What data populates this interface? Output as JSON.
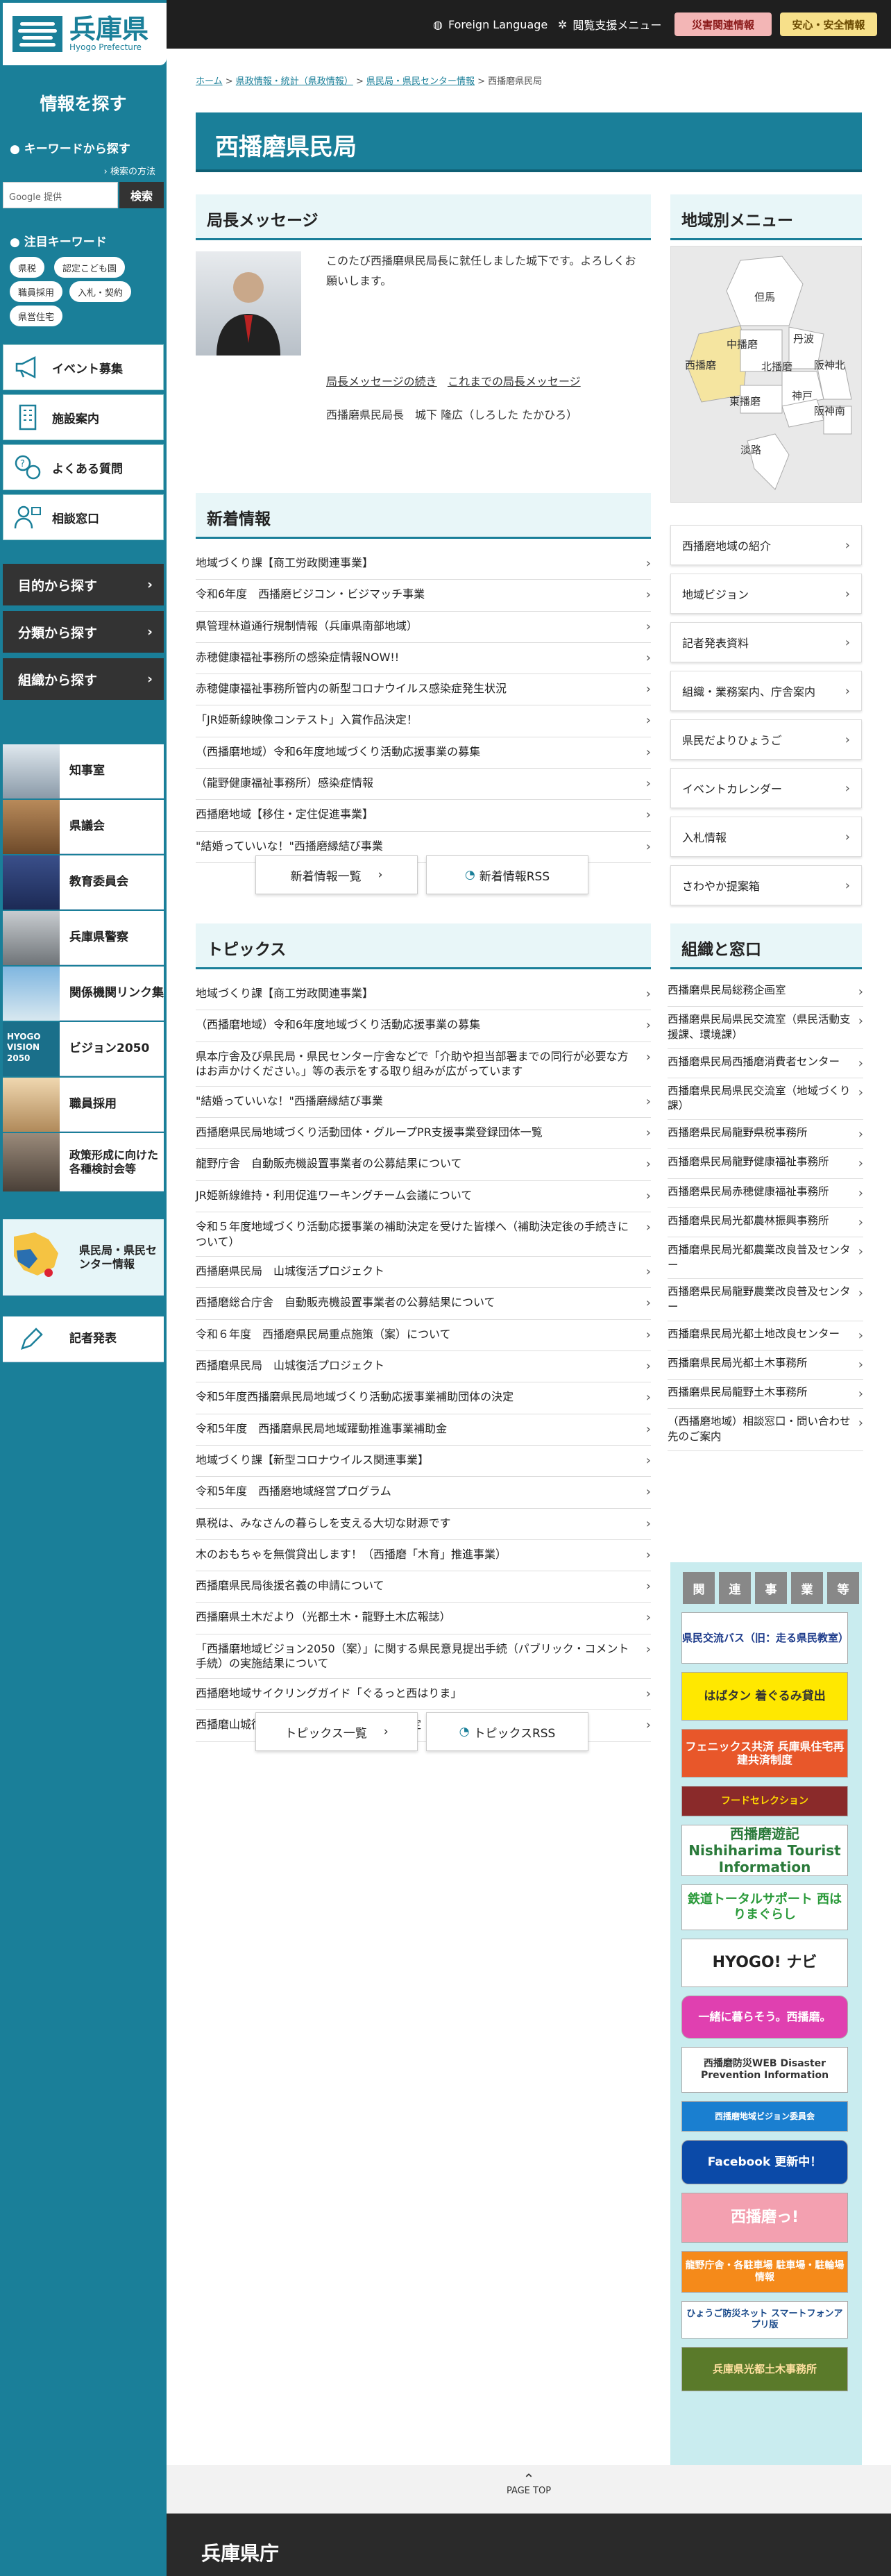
{
  "header": {
    "logo_title": "兵庫県",
    "logo_sub": "Hyogo Prefecture",
    "foreign": "Foreign Language",
    "browse_support": "閲覧支援メニュー",
    "disaster": "災害関連情報",
    "safety": "安心・安全情報"
  },
  "sidebar": {
    "heading": "情報を探す",
    "keyword_heading": "キーワードから探す",
    "search_howto": "検索の方法",
    "search_placeholder": "Google 提供",
    "search_button": "検索",
    "hot_heading": "注目キーワード",
    "tags": [
      "県税",
      "認定こども園",
      "職員採用",
      "入札・契約",
      "県営住宅"
    ],
    "quick": [
      "イベント募集",
      "施設案内",
      "よくある質問",
      "相談窓口"
    ],
    "find": [
      "目的から探す",
      "分類から探す",
      "組織から探す"
    ],
    "pics": [
      "知事室",
      "県議会",
      "教育委員会",
      "兵庫県警察",
      "関係機関リンク集",
      "ビジョン2050",
      "職員採用",
      "政策形成に向けた各種検討会等"
    ],
    "vision_text": "HYOGO VISION 2050",
    "map_link": "県民局・県民センター情報",
    "press": "記者発表"
  },
  "breadcrumb": {
    "items": [
      "ホーム",
      "県政情報・統計（県政情報）",
      "県民局・県民センター情報"
    ],
    "current": "西播磨県民局"
  },
  "page_title": "西播磨県民局",
  "director": {
    "heading": "局長メッセージ",
    "message": "このたび西播磨県民局長に就任しました城下です。よろしくお願いします。",
    "link_more": "局長メッセージの続き",
    "link_past": "これまでの局長メッセージ",
    "name": "西播磨県民局長　城下 隆広（しろした たかひろ）"
  },
  "news": {
    "heading": "新着情報",
    "items": [
      "地域づくり課【商工労政関連事業】",
      "令和6年度　西播磨ビジコン・ビジマッチ事業",
      "県管理林道通行規制情報（兵庫県南部地域）",
      "赤穂健康福祉事務所の感染症情報NOW!!",
      "赤穂健康福祉事務所管内の新型コロナウイルス感染症発生状況",
      "「JR姫新線映像コンテスト」入賞作品決定！",
      "（西播磨地域）令和6年度地域づくり活動応援事業の募集",
      "（龍野健康福祉事務所）感染症情報",
      "西播磨地域【移住・定住促進事業】",
      "\"結婚っていいな！\"西播磨縁結び事業"
    ],
    "list_button": "新着情報一覧",
    "rss_button": "新着情報RSS"
  },
  "topics": {
    "heading": "トピックス",
    "items": [
      "地域づくり課【商工労政関連事業】",
      "（西播磨地域）令和6年度地域づくり活動応援事業の募集",
      "県本庁舎及び県民局・県民センター庁舎などで「介助や担当部署までの同行が必要な方はお声かけください。」等の表示をする取り組みが広がっています",
      "\"結婚っていいな！\"西播磨縁結び事業",
      "西播磨県民局地域づくり活動団体・グループPR支援事業登録団体一覧",
      "龍野庁舎　自動販売機設置事業者の公募結果について",
      "JR姫新線維持・利用促進ワーキングチーム会議について",
      "令和５年度地域づくり活動応援事業の補助決定を受けた皆様へ（補助決定後の手続きについて）",
      "西播磨県民局　山城復活プロジェクト",
      "西播磨総合庁舎　自動販売機設置事業者の公募結果について",
      "令和６年度　西播磨県民局重点施策（案）について",
      "西播磨県民局　山城復活プロジェクト",
      "令和5年度西播磨県民局地域づくり活動応援事業補助団体の決定",
      "令和5年度　西播磨県民局地域躍動推進事業補助金",
      "地域づくり課【新型コロナウイルス関連事業】",
      "令和5年度　西播磨地域経営プログラム",
      "県税は、みなさんの暮らしを支える大切な財源です",
      "木のおもちゃを無償貸出します！（西播磨「木育」推進事業）",
      "西播磨県民局後援名義の申請について",
      "西播磨県土木だより（光都土木・龍野土木広報誌）",
      "「西播磨地域ビジョン2050（案）」に関する県民意見提出手続（パブリック・コメント手続）の実施結果について",
      "西播磨地域サイクリングガイド「ぐるっと西はりま」",
      "西播磨山城復活プロジェクト ロゴマーク決定"
    ],
    "list_button": "トピックス一覧",
    "rss_button": "トピックスRSS"
  },
  "area_menu": {
    "heading": "地域別メニュー",
    "regions": [
      "但馬",
      "中播磨",
      "丹波",
      "西播磨",
      "北播磨",
      "阪神北",
      "東播磨",
      "神戸",
      "阪神南",
      "淡路"
    ],
    "links": [
      "西播磨地域の紹介",
      "地域ビジョン",
      "記者発表資料",
      "組織・業務案内、庁舎案内",
      "県民だよりひょうご",
      "イベントカレンダー",
      "入札情報",
      "さわやか提案箱"
    ]
  },
  "org": {
    "heading": "組織と窓口",
    "items": [
      "西播磨県民局総務企画室",
      "西播磨県民局県民交流室（県民活動支援課、環境課）",
      "西播磨県民局西播磨消費者センター",
      "西播磨県民局県民交流室（地域づくり課）",
      "西播磨県民局龍野県税事務所",
      "西播磨県民局龍野健康福祉事務所",
      "西播磨県民局赤穂健康福祉事務所",
      "西播磨県民局光都農林振興事務所",
      "西播磨県民局光都農業改良普及センター",
      "西播磨県民局龍野農業改良普及センター",
      "西播磨県民局光都土地改良センター",
      "西播磨県民局光都土木事務所",
      "西播磨県民局龍野土木事務所",
      "（西播磨地域）相談窓口・問い合わせ先のご案内"
    ]
  },
  "related": {
    "chars": [
      "関",
      "連",
      "事",
      "業",
      "等"
    ],
    "banners": [
      "県民交流バス（旧：走る県民教室）",
      "はばタン 着ぐるみ貸出",
      "フェニックス共済 兵庫県住宅再建共済制度",
      "フードセレクション",
      "西播磨遊記 Nishiharima Tourist Information",
      "鉄道トータルサポート 西はりまぐらし",
      "HYOGO! ナビ",
      "一緒に暮らそう。西播磨。",
      "西播磨防災WEB Disaster Prevention Information",
      "西播磨地域ビジョン委員会",
      "Facebook 更新中！",
      "西播磨っ!",
      "龍野庁舎・各駐車場 駐車場・駐輪場情報",
      "ひょうご防災ネット スマートフォンアプリ版",
      "兵庫県光都土木事務所"
    ]
  },
  "page_top": "PAGE TOP",
  "footer": {
    "title": "兵庫県庁"
  },
  "colors": {
    "primary": "#1a7f99",
    "dark": "#1f1f1f",
    "alert": "#f3b6b6",
    "safety": "#f7e08a",
    "panel": "#e8f6f8"
  }
}
